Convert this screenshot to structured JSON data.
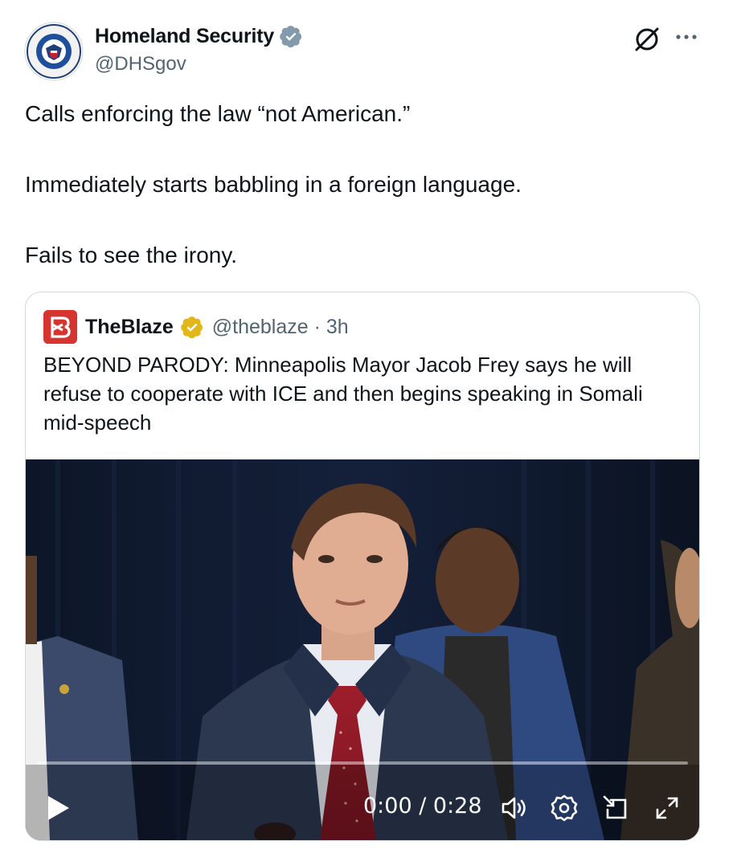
{
  "author": {
    "display_name": "Homeland Security",
    "handle": "@DHSgov"
  },
  "tweet": {
    "paragraphs": [
      "Calls enforcing the law “not American.”",
      "Immediately starts babbling in a foreign language.",
      "Fails to see the irony."
    ]
  },
  "quoted": {
    "display_name": "TheBlaze",
    "handle_time": "@theblaze · 3h",
    "text": "BEYOND PARODY: Minneapolis Mayor Jacob Frey says he will refuse to cooperate with ICE and then begins speaking in Somali mid-speech",
    "video": {
      "time": "0:00 / 0:28",
      "progress": 0.0
    }
  },
  "icons": {
    "verified_gray": "verified-badge-gray-icon",
    "verified_gold": "verified-badge-gold-icon",
    "grok": "grok-icon",
    "more": "more-icon",
    "play": "play-icon",
    "volume": "volume-icon",
    "settings": "settings-icon",
    "pip": "picture-in-picture-icon",
    "fullscreen": "fullscreen-icon"
  },
  "colors": {
    "accent_verified_gray": "#829aab",
    "accent_verified_gold": "#e2b719",
    "blaze_red": "#d6342f",
    "text_secondary": "#536471",
    "border": "#cfd9de"
  }
}
